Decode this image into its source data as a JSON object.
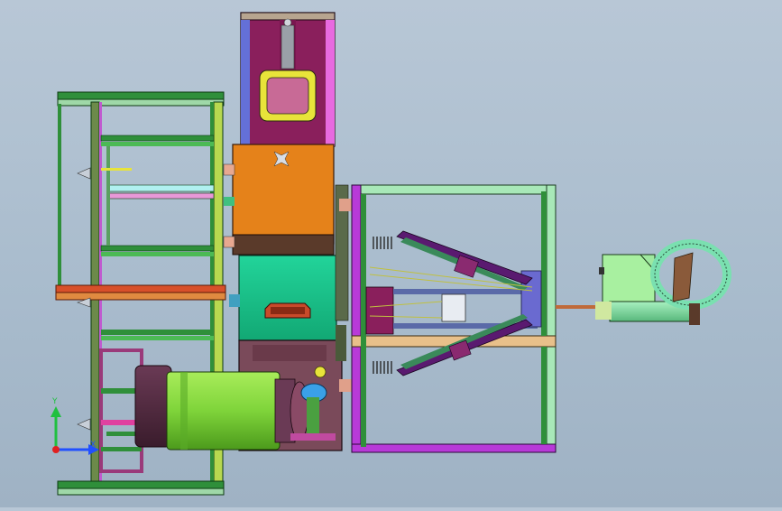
{
  "viewport": {
    "background_top": "#b8c7d6",
    "background_bottom": "#9fb2c4"
  },
  "triad": {
    "y_label": "Y",
    "z_label": "Z",
    "x_label": "X",
    "y_color": "#20c040",
    "x_color": "#2050ff",
    "origin_color": "#e02020"
  },
  "colors": {
    "frame_green": "#2f8f3a",
    "frame_light": "#9fd8a8",
    "hopper_purple": "#8a1f5c",
    "hopper_ring": "#e8e43a",
    "orange_box": "#e5821a",
    "teal_box": "#18c08a",
    "motor_green": "#7fd43a",
    "cage_pink": "#b83ad8",
    "cage_tan": "#e8c08a"
  }
}
